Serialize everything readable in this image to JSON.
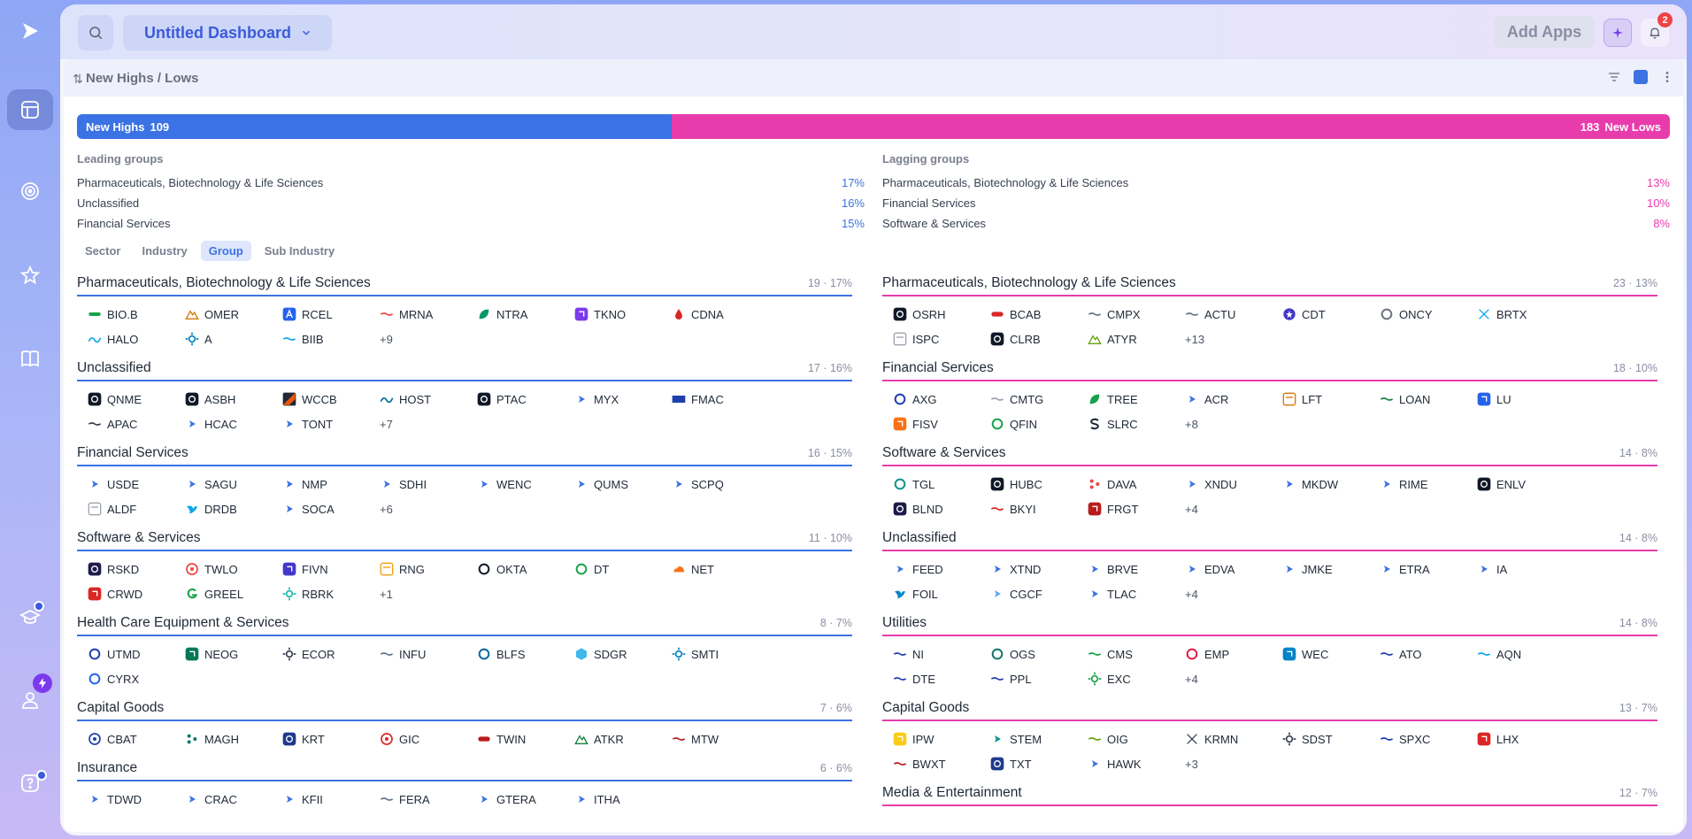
{
  "app": {
    "dashboard_title": "Untitled Dashboard",
    "add_apps_label": "Add Apps",
    "notification_count": "2"
  },
  "widget": {
    "title": "New Highs / Lows",
    "bar": {
      "highs_label": "New Highs",
      "highs_count": "109",
      "lows_label": "New Lows",
      "lows_count": "183",
      "highs_fraction": 0.3733
    },
    "leading": {
      "title": "Leading groups",
      "rows": [
        {
          "name": "Pharmaceuticals, Biotechnology & Life Sciences",
          "pct": "17%"
        },
        {
          "name": "Unclassified",
          "pct": "16%"
        },
        {
          "name": "Financial Services",
          "pct": "15%"
        }
      ]
    },
    "lagging": {
      "title": "Lagging groups",
      "rows": [
        {
          "name": "Pharmaceuticals, Biotechnology & Life Sciences",
          "pct": "13%"
        },
        {
          "name": "Financial Services",
          "pct": "10%"
        },
        {
          "name": "Software & Services",
          "pct": "8%"
        }
      ]
    },
    "tabs": [
      "Sector",
      "Industry",
      "Group",
      "Sub Industry"
    ],
    "active_tab": "Group",
    "highs_sections": [
      {
        "title": "Pharmaceuticals, Biotechnology & Life Sciences",
        "meta": "19 · 17%",
        "tickers": [
          {
            "s": "BIO.B",
            "icon": "green-bar",
            "c": "#16a34a"
          },
          {
            "s": "OMER",
            "icon": "mountain",
            "c": "#d97706"
          },
          {
            "s": "RCEL",
            "icon": "letter-a",
            "c": "#2563eb"
          },
          {
            "s": "MRNA",
            "icon": "dash",
            "c": "#ef4444"
          },
          {
            "s": "NTRA",
            "icon": "leaf",
            "c": "#059669"
          },
          {
            "s": "TKNO",
            "icon": "square",
            "c": "#7c3aed"
          },
          {
            "s": "CDNA",
            "icon": "drop",
            "c": "#dc2626"
          },
          {
            "s": "HALO",
            "icon": "wave",
            "c": "#0ea5e9"
          },
          {
            "s": "A",
            "icon": "gear",
            "c": "#0284c7"
          },
          {
            "s": "BIIB",
            "icon": "dash",
            "c": "#0ea5e9"
          }
        ],
        "more": "+9"
      },
      {
        "title": "Unclassified",
        "meta": "17 · 16%",
        "tickers": [
          {
            "s": "QNME",
            "icon": "dark-square",
            "c": "#111827"
          },
          {
            "s": "ASBH",
            "icon": "dark-square",
            "c": "#111827"
          },
          {
            "s": "WCCB",
            "icon": "stripe",
            "c": "#ea580c"
          },
          {
            "s": "HOST",
            "icon": "wave",
            "c": "#0369a1"
          },
          {
            "s": "PTAC",
            "icon": "dark-square",
            "c": "#111827"
          },
          {
            "s": "MYX",
            "icon": "play",
            "c": "#3b72e4"
          },
          {
            "s": "FMAC",
            "icon": "flag",
            "c": "#1e40af"
          },
          {
            "s": "APAC",
            "icon": "dash",
            "c": "#374151"
          },
          {
            "s": "HCAC",
            "icon": "play",
            "c": "#3b72e4"
          },
          {
            "s": "TONT",
            "icon": "play",
            "c": "#3b72e4"
          }
        ],
        "more": "+7"
      },
      {
        "title": "Financial Services",
        "meta": "16 · 15%",
        "tickers": [
          {
            "s": "USDE",
            "icon": "play",
            "c": "#3b72e4"
          },
          {
            "s": "SAGU",
            "icon": "play",
            "c": "#3b72e4"
          },
          {
            "s": "NMP",
            "icon": "play",
            "c": "#3b72e4"
          },
          {
            "s": "SDHI",
            "icon": "play",
            "c": "#3b72e4"
          },
          {
            "s": "WENC",
            "icon": "play",
            "c": "#3b72e4"
          },
          {
            "s": "QUMS",
            "icon": "play",
            "c": "#3b72e4"
          },
          {
            "s": "SCPQ",
            "icon": "play",
            "c": "#3b72e4"
          },
          {
            "s": "ALDF",
            "icon": "box",
            "c": "#9ca3af"
          },
          {
            "s": "DRDB",
            "icon": "bird",
            "c": "#0ea5e9"
          },
          {
            "s": "SOCA",
            "icon": "play",
            "c": "#3b72e4"
          }
        ],
        "more": "+6"
      },
      {
        "title": "Software & Services",
        "meta": "11 · 10%",
        "tickers": [
          {
            "s": "RSKD",
            "icon": "dark-square",
            "c": "#1e1b4b"
          },
          {
            "s": "TWLO",
            "icon": "circle",
            "c": "#ef4444"
          },
          {
            "s": "FIVN",
            "icon": "square",
            "c": "#4338ca"
          },
          {
            "s": "RNG",
            "icon": "box",
            "c": "#f59e0b"
          },
          {
            "s": "OKTA",
            "icon": "ring",
            "c": "#111827"
          },
          {
            "s": "DT",
            "icon": "ring",
            "c": "#16a34a"
          },
          {
            "s": "NET",
            "icon": "cloud",
            "c": "#f97316"
          },
          {
            "s": "CRWD",
            "icon": "square",
            "c": "#dc2626"
          },
          {
            "s": "GREEL",
            "icon": "letter-g",
            "c": "#16a34a"
          },
          {
            "s": "RBRK",
            "icon": "gear",
            "c": "#14b8a6"
          }
        ],
        "more": "+1"
      },
      {
        "title": "Health Care Equipment & Services",
        "meta": "8 · 7%",
        "tickers": [
          {
            "s": "UTMD",
            "icon": "ring",
            "c": "#1e40af"
          },
          {
            "s": "NEOG",
            "icon": "square",
            "c": "#047857"
          },
          {
            "s": "ECOR",
            "icon": "gear",
            "c": "#374151"
          },
          {
            "s": "INFU",
            "icon": "dash",
            "c": "#64748b"
          },
          {
            "s": "BLFS",
            "icon": "ring",
            "c": "#0369a1"
          },
          {
            "s": "SDGR",
            "icon": "cube",
            "c": "#0ea5e9"
          },
          {
            "s": "SMTI",
            "icon": "gear",
            "c": "#0284c7"
          },
          {
            "s": "CYRX",
            "icon": "ring",
            "c": "#2563eb"
          }
        ],
        "more": ""
      },
      {
        "title": "Capital Goods",
        "meta": "7 · 6%",
        "tickers": [
          {
            "s": "CBAT",
            "icon": "circle",
            "c": "#1e40af"
          },
          {
            "s": "MAGH",
            "icon": "dots",
            "c": "#0f766e"
          },
          {
            "s": "KRT",
            "icon": "dark-square",
            "c": "#1e3a8a"
          },
          {
            "s": "GIC",
            "icon": "circle",
            "c": "#dc2626"
          },
          {
            "s": "TWIN",
            "icon": "pill",
            "c": "#b91c1c"
          },
          {
            "s": "ATKR",
            "icon": "mountain",
            "c": "#15803d"
          },
          {
            "s": "MTW",
            "icon": "dash",
            "c": "#b91c1c"
          }
        ],
        "more": ""
      },
      {
        "title": "Insurance",
        "meta": "6 · 6%",
        "tickers": [
          {
            "s": "TDWD",
            "icon": "play",
            "c": "#3b72e4"
          },
          {
            "s": "CRAC",
            "icon": "play",
            "c": "#3b72e4"
          },
          {
            "s": "KFII",
            "icon": "play",
            "c": "#3b72e4"
          },
          {
            "s": "FERA",
            "icon": "dash",
            "c": "#64748b"
          },
          {
            "s": "GTERA",
            "icon": "play",
            "c": "#3b72e4"
          },
          {
            "s": "ITHA",
            "icon": "play",
            "c": "#3b72e4"
          }
        ],
        "more": ""
      }
    ],
    "lows_sections": [
      {
        "title": "Pharmaceuticals, Biotechnology & Life Sciences",
        "meta": "23 · 13%",
        "tickers": [
          {
            "s": "OSRH",
            "icon": "dark-square",
            "c": "#111827"
          },
          {
            "s": "BCAB",
            "icon": "pill",
            "c": "#dc2626"
          },
          {
            "s": "CMPX",
            "icon": "dash",
            "c": "#64748b"
          },
          {
            "s": "ACTU",
            "icon": "dash",
            "c": "#64748b"
          },
          {
            "s": "CDT",
            "icon": "star",
            "c": "#4338ca"
          },
          {
            "s": "ONCY",
            "icon": "ring",
            "c": "#6b7280"
          },
          {
            "s": "BRTX",
            "icon": "cross",
            "c": "#0ea5e9"
          },
          {
            "s": "ISPC",
            "icon": "box",
            "c": "#9ca3af"
          },
          {
            "s": "CLRB",
            "icon": "dark-square",
            "c": "#111827"
          },
          {
            "s": "ATYR",
            "icon": "mountain",
            "c": "#65a30d"
          }
        ],
        "more": "+13"
      },
      {
        "title": "Financial Services",
        "meta": "18 · 10%",
        "tickers": [
          {
            "s": "AXG",
            "icon": "ring",
            "c": "#1e40af"
          },
          {
            "s": "CMTG",
            "icon": "dash",
            "c": "#9ca3af"
          },
          {
            "s": "TREE",
            "icon": "leaf",
            "c": "#16a34a"
          },
          {
            "s": "ACR",
            "icon": "play",
            "c": "#3b72e4"
          },
          {
            "s": "LFT",
            "icon": "box",
            "c": "#d97706"
          },
          {
            "s": "LOAN",
            "icon": "dash",
            "c": "#15803d"
          },
          {
            "s": "LU",
            "icon": "square",
            "c": "#2563eb"
          },
          {
            "s": "FISV",
            "icon": "square",
            "c": "#f97316"
          },
          {
            "s": "QFIN",
            "icon": "ring",
            "c": "#16a34a"
          },
          {
            "s": "SLRC",
            "icon": "letter-s",
            "c": "#1f2937"
          }
        ],
        "more": "+8"
      },
      {
        "title": "Software & Services",
        "meta": "14 · 8%",
        "tickers": [
          {
            "s": "TGL",
            "icon": "ring",
            "c": "#0d9488"
          },
          {
            "s": "HUBC",
            "icon": "dark-square",
            "c": "#111827"
          },
          {
            "s": "DAVA",
            "icon": "dots",
            "c": "#ef4444"
          },
          {
            "s": "XNDU",
            "icon": "play",
            "c": "#3b72e4"
          },
          {
            "s": "MKDW",
            "icon": "play",
            "c": "#3b72e4"
          },
          {
            "s": "RIME",
            "icon": "play",
            "c": "#3b72e4"
          },
          {
            "s": "ENLV",
            "icon": "dark-square",
            "c": "#111827"
          },
          {
            "s": "BLND",
            "icon": "dark-square",
            "c": "#1e1b4b"
          },
          {
            "s": "BKYI",
            "icon": "dash",
            "c": "#dc2626"
          },
          {
            "s": "FRGT",
            "icon": "square",
            "c": "#b91c1c"
          }
        ],
        "more": "+4"
      },
      {
        "title": "Unclassified",
        "meta": "14 · 8%",
        "tickers": [
          {
            "s": "FEED",
            "icon": "play",
            "c": "#3b72e4"
          },
          {
            "s": "XTND",
            "icon": "play",
            "c": "#3b72e4"
          },
          {
            "s": "BRVE",
            "icon": "play",
            "c": "#3b72e4"
          },
          {
            "s": "EDVA",
            "icon": "play",
            "c": "#3b72e4"
          },
          {
            "s": "JMKE",
            "icon": "play",
            "c": "#3b72e4"
          },
          {
            "s": "ETRA",
            "icon": "play",
            "c": "#3b72e4"
          },
          {
            "s": "IA",
            "icon": "play",
            "c": "#3b72e4"
          },
          {
            "s": "FOIL",
            "icon": "bird",
            "c": "#0284c7"
          },
          {
            "s": "CGCF",
            "icon": "play",
            "c": "#60a5fa"
          },
          {
            "s": "TLAC",
            "icon": "play",
            "c": "#3b72e4"
          }
        ],
        "more": "+4"
      },
      {
        "title": "Utilities",
        "meta": "14 · 8%",
        "tickers": [
          {
            "s": "NI",
            "icon": "dash",
            "c": "#1e40af"
          },
          {
            "s": "OGS",
            "icon": "ring",
            "c": "#0f766e"
          },
          {
            "s": "CMS",
            "icon": "dash",
            "c": "#16a34a"
          },
          {
            "s": "EMP",
            "icon": "ring",
            "c": "#e11d48"
          },
          {
            "s": "WEC",
            "icon": "square",
            "c": "#0284c7"
          },
          {
            "s": "ATO",
            "icon": "dash",
            "c": "#1e40af"
          },
          {
            "s": "AQN",
            "icon": "dash",
            "c": "#0ea5e9"
          },
          {
            "s": "DTE",
            "icon": "dash",
            "c": "#1e40af"
          },
          {
            "s": "PPL",
            "icon": "dash",
            "c": "#1e40af"
          },
          {
            "s": "EXC",
            "icon": "gear",
            "c": "#16a34a"
          }
        ],
        "more": "+4"
      },
      {
        "title": "Capital Goods",
        "meta": "13 · 7%",
        "tickers": [
          {
            "s": "IPW",
            "icon": "square",
            "c": "#facc15"
          },
          {
            "s": "STEM",
            "icon": "play",
            "c": "#0d9488"
          },
          {
            "s": "OIG",
            "icon": "dash",
            "c": "#65a30d"
          },
          {
            "s": "KRMN",
            "icon": "cross",
            "c": "#374151"
          },
          {
            "s": "SDST",
            "icon": "gear",
            "c": "#374151"
          },
          {
            "s": "SPXC",
            "icon": "dash",
            "c": "#1e40af"
          },
          {
            "s": "LHX",
            "icon": "square",
            "c": "#dc2626"
          },
          {
            "s": "BWXT",
            "icon": "dash",
            "c": "#b91c1c"
          },
          {
            "s": "TXT",
            "icon": "dark-square",
            "c": "#1e3a8a"
          },
          {
            "s": "HAWK",
            "icon": "play",
            "c": "#3b72e4"
          }
        ],
        "more": "+3"
      },
      {
        "title": "Media & Entertainment",
        "meta": "12 · 7%",
        "tickers": [],
        "more": ""
      }
    ]
  }
}
